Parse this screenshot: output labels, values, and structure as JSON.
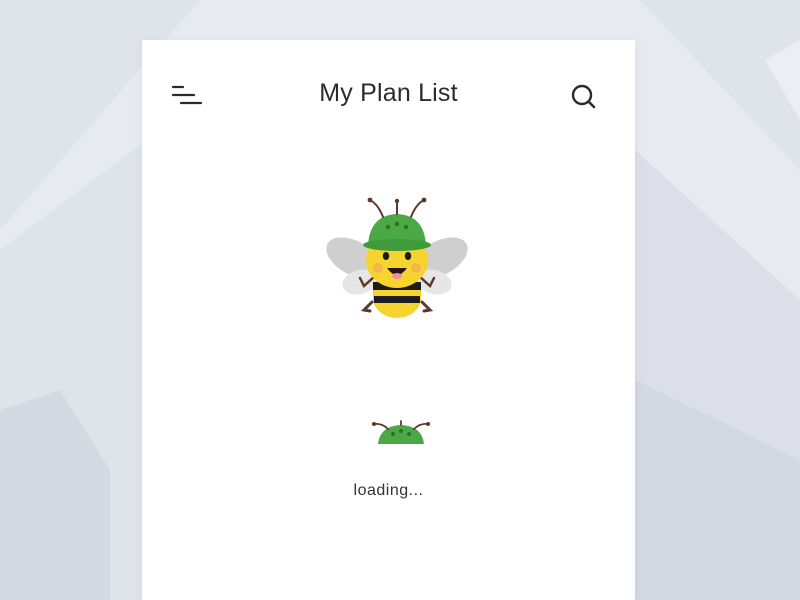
{
  "header": {
    "title": "My Plan List",
    "menu_icon": "menu-icon",
    "search_icon": "search-icon"
  },
  "status": {
    "loading_text": "loading..."
  },
  "illustration": {
    "main": "bee-mascot-with-helmet",
    "loader": "helmet-loader-icon"
  },
  "colors": {
    "background": "#e7eaf0",
    "card": "#ffffff",
    "helmet_green": "#4aa944",
    "bee_yellow": "#f6d32e",
    "stripe_black": "#1c1c1c",
    "text": "#2b2b2b"
  }
}
